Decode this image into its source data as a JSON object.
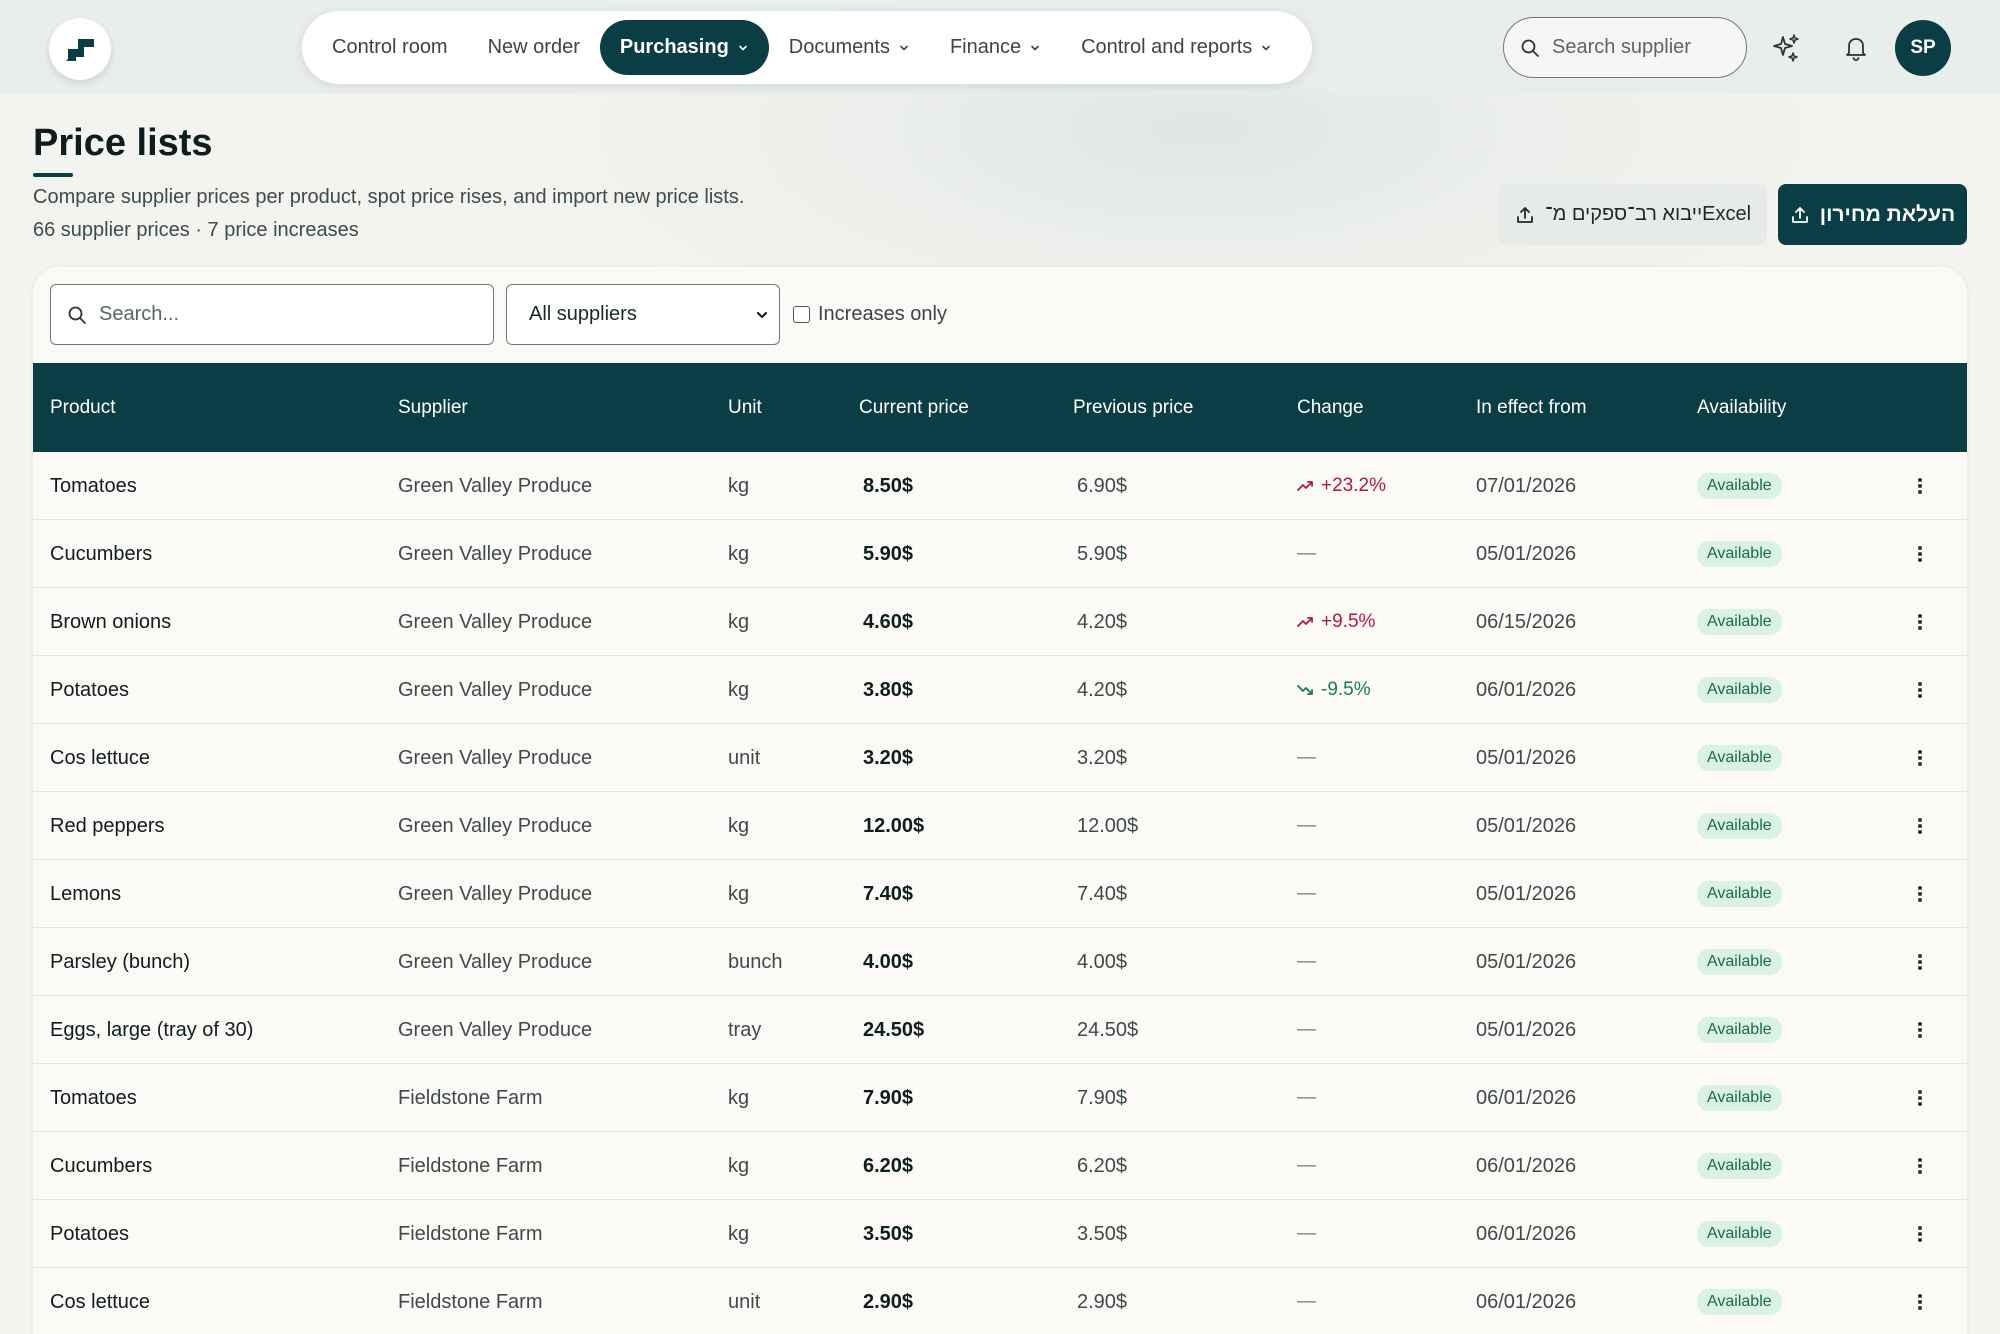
{
  "nav": {
    "items": [
      {
        "label": "Control room",
        "active": false,
        "dropdown": false
      },
      {
        "label": "New order",
        "active": false,
        "dropdown": false
      },
      {
        "label": "Purchasing",
        "active": true,
        "dropdown": true
      },
      {
        "label": "Documents",
        "active": false,
        "dropdown": true
      },
      {
        "label": "Finance",
        "active": false,
        "dropdown": true
      },
      {
        "label": "Control and reports",
        "active": false,
        "dropdown": true
      }
    ]
  },
  "header": {
    "search_placeholder": "Search supplier",
    "avatar_initials": "SP",
    "icons": [
      "sparkle-icon",
      "bell-icon"
    ]
  },
  "page": {
    "title": "Price lists",
    "subtitle": "Compare supplier prices per product, spot price rises, and import new price lists.",
    "stats": "66 supplier prices · 7 price increases",
    "import_button": "ייבוא רב־ספקים מ־Excel",
    "upload_button": "העלאת מחירון"
  },
  "filters": {
    "search_placeholder": "Search...",
    "supplier_selected": "All suppliers",
    "increases_only_label": "Increases only",
    "increases_only_checked": false
  },
  "table": {
    "columns": [
      "Product",
      "Supplier",
      "Unit",
      "Current price",
      "Previous price",
      "Change",
      "In effect from",
      "Availability"
    ],
    "rows": [
      {
        "product": "Tomatoes",
        "supplier": "Green Valley Produce",
        "unit": "kg",
        "current": "8.50$",
        "previous": "6.90$",
        "change": "+23.2%",
        "direction": "up",
        "effective": "07/01/2026",
        "availability": "Available"
      },
      {
        "product": "Cucumbers",
        "supplier": "Green Valley Produce",
        "unit": "kg",
        "current": "5.90$",
        "previous": "5.90$",
        "change": "—",
        "direction": "none",
        "effective": "05/01/2026",
        "availability": "Available"
      },
      {
        "product": "Brown onions",
        "supplier": "Green Valley Produce",
        "unit": "kg",
        "current": "4.60$",
        "previous": "4.20$",
        "change": "+9.5%",
        "direction": "up",
        "effective": "06/15/2026",
        "availability": "Available"
      },
      {
        "product": "Potatoes",
        "supplier": "Green Valley Produce",
        "unit": "kg",
        "current": "3.80$",
        "previous": "4.20$",
        "change": "-9.5%",
        "direction": "down",
        "effective": "06/01/2026",
        "availability": "Available"
      },
      {
        "product": "Cos lettuce",
        "supplier": "Green Valley Produce",
        "unit": "unit",
        "current": "3.20$",
        "previous": "3.20$",
        "change": "—",
        "direction": "none",
        "effective": "05/01/2026",
        "availability": "Available"
      },
      {
        "product": "Red peppers",
        "supplier": "Green Valley Produce",
        "unit": "kg",
        "current": "12.00$",
        "previous": "12.00$",
        "change": "—",
        "direction": "none",
        "effective": "05/01/2026",
        "availability": "Available"
      },
      {
        "product": "Lemons",
        "supplier": "Green Valley Produce",
        "unit": "kg",
        "current": "7.40$",
        "previous": "7.40$",
        "change": "—",
        "direction": "none",
        "effective": "05/01/2026",
        "availability": "Available"
      },
      {
        "product": "Parsley (bunch)",
        "supplier": "Green Valley Produce",
        "unit": "bunch",
        "current": "4.00$",
        "previous": "4.00$",
        "change": "—",
        "direction": "none",
        "effective": "05/01/2026",
        "availability": "Available"
      },
      {
        "product": "Eggs, large (tray of 30)",
        "supplier": "Green Valley Produce",
        "unit": "tray",
        "current": "24.50$",
        "previous": "24.50$",
        "change": "—",
        "direction": "none",
        "effective": "05/01/2026",
        "availability": "Available"
      },
      {
        "product": "Tomatoes",
        "supplier": "Fieldstone Farm",
        "unit": "kg",
        "current": "7.90$",
        "previous": "7.90$",
        "change": "—",
        "direction": "none",
        "effective": "06/01/2026",
        "availability": "Available"
      },
      {
        "product": "Cucumbers",
        "supplier": "Fieldstone Farm",
        "unit": "kg",
        "current": "6.20$",
        "previous": "6.20$",
        "change": "—",
        "direction": "none",
        "effective": "06/01/2026",
        "availability": "Available"
      },
      {
        "product": "Potatoes",
        "supplier": "Fieldstone Farm",
        "unit": "kg",
        "current": "3.50$",
        "previous": "3.50$",
        "change": "—",
        "direction": "none",
        "effective": "06/01/2026",
        "availability": "Available"
      },
      {
        "product": "Cos lettuce",
        "supplier": "Fieldstone Farm",
        "unit": "unit",
        "current": "2.90$",
        "previous": "2.90$",
        "change": "—",
        "direction": "none",
        "effective": "06/01/2026",
        "availability": "Available"
      }
    ]
  },
  "colors": {
    "brand": "#0a3d44",
    "increase": "#b3174a",
    "decrease": "#1a7a55",
    "available_bg": "#daf1e5",
    "available_text": "#1a6b48"
  }
}
